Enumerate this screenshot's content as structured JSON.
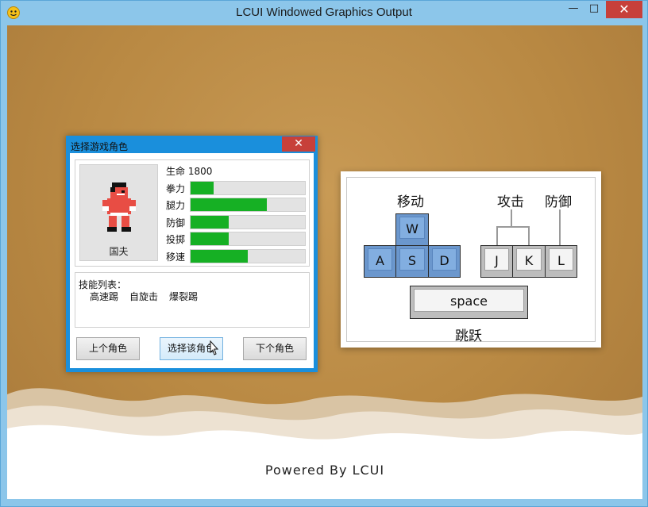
{
  "window": {
    "title": "LCUI Windowed Graphics Output",
    "minimize": "—",
    "maximize": "□",
    "close": "✕"
  },
  "dialog": {
    "title": "选择游戏角色",
    "close": "✕",
    "character": {
      "name": "国夫",
      "hp_label": "生命",
      "hp": "1800"
    },
    "stats": [
      {
        "label": "拳力",
        "value": 0.2
      },
      {
        "label": "腿力",
        "value": 0.67
      },
      {
        "label": "防御",
        "value": 0.33
      },
      {
        "label": "投掷",
        "value": 0.33
      },
      {
        "label": "移速",
        "value": 0.5
      }
    ],
    "skills_title": "技能列表：",
    "skills": [
      "高速踢",
      "自旋击",
      "爆裂踢"
    ],
    "buttons": {
      "prev": "上个角色",
      "select": "选择该角色",
      "next": "下个角色"
    }
  },
  "controls": {
    "move_label": "移动",
    "attack_label": "攻击",
    "defend_label": "防御",
    "jump_label": "跳跃",
    "keys": {
      "w": "W",
      "a": "A",
      "s": "S",
      "d": "D",
      "j": "J",
      "k": "K",
      "l": "L",
      "space": "space"
    }
  },
  "footer": "Powered  By  LCUI",
  "colors": {
    "accent": "#1a8fdc",
    "stat_fill": "#16b024",
    "close": "#c7403a",
    "move_keys": "#82aee0",
    "background": "#b98943"
  }
}
